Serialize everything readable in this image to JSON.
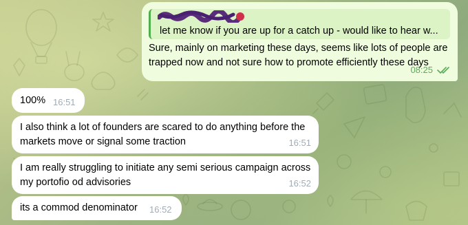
{
  "chat": {
    "outgoing_message": {
      "reply_preview_text": "let me know if you are up for a catch up - would like to hear w...",
      "text": "Sure, mainly on marketing these days, seems like lots of people are trapped now and not sure how to promote efficiently these days",
      "time": "08:25",
      "status_icon": "double-check-icon"
    },
    "incoming_messages": [
      {
        "text": "100%",
        "time": "16:51"
      },
      {
        "text": "I also think a lot of founders are scared to do anything before the markets move or signal some traction",
        "time": "16:51"
      },
      {
        "text": "I am really struggling to initiate any semi serious campaign across my portofio od advisories",
        "time": "16:52"
      },
      {
        "text": "its a commod denominator",
        "time": "16:52"
      }
    ]
  },
  "colors": {
    "outgoing_bubble": "#effdde",
    "incoming_bubble": "#ffffff",
    "reply_accent": "#4fae4e",
    "time_outgoing": "#5bab5a",
    "time_incoming": "#a0acb6",
    "redaction_scribble": "#5a2d7a"
  }
}
